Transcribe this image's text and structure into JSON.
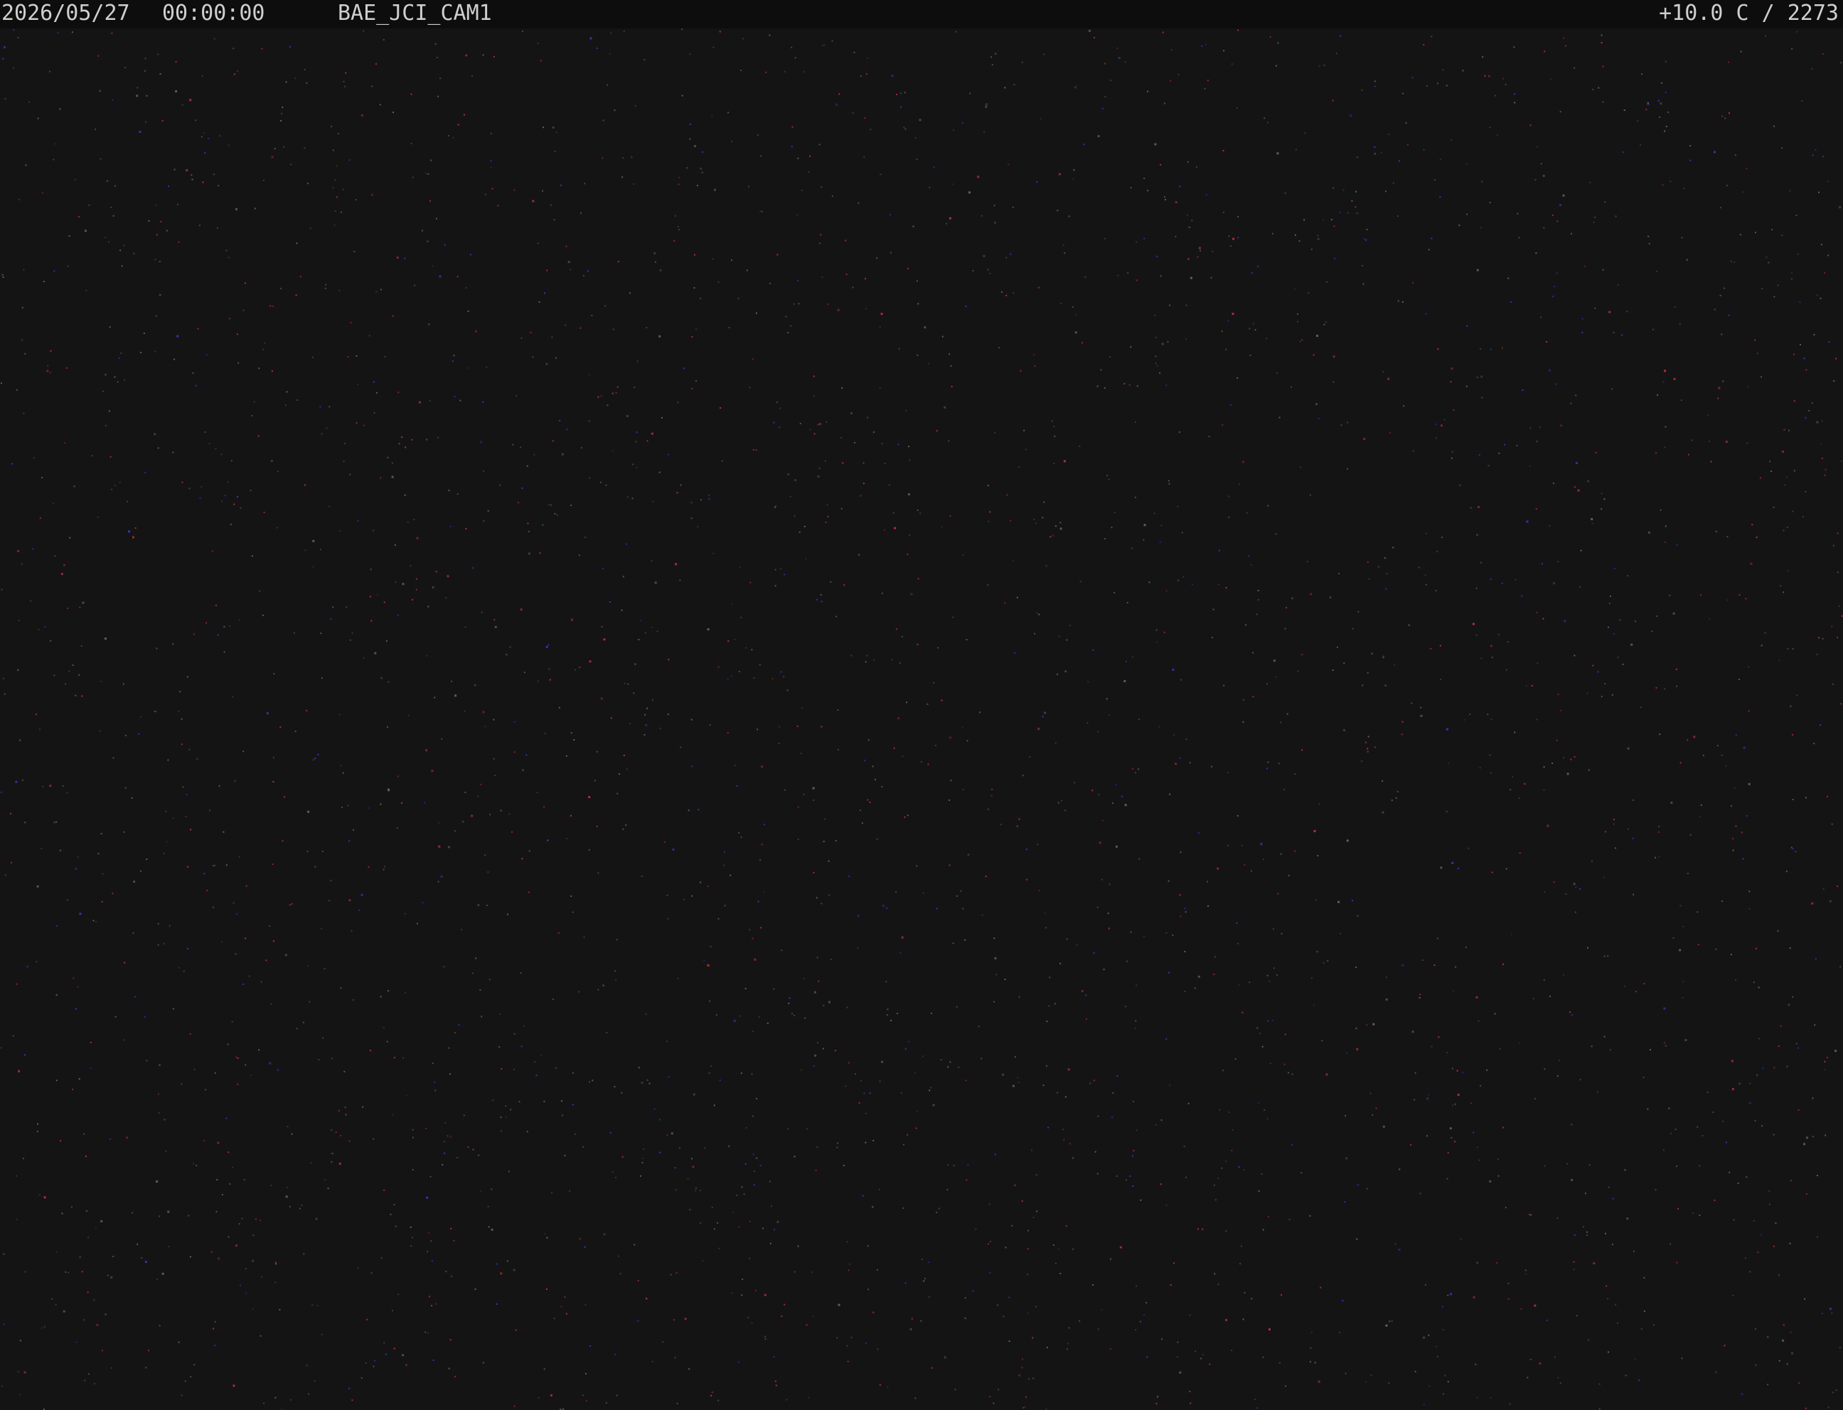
{
  "overlay": {
    "date": "2026/05/27",
    "time": "00:00:00",
    "camera_name": "BAE_JCI_CAM1",
    "temperature_exposure": "+10.0 C / 2273"
  },
  "colors": {
    "background": "#141414",
    "overlay_bar": "#0d0d0d",
    "overlay_text": "#cfcfcf",
    "star_red": "#c83040",
    "star_blue": "#3a3ad0",
    "star_gray": "#6a6a6a"
  }
}
